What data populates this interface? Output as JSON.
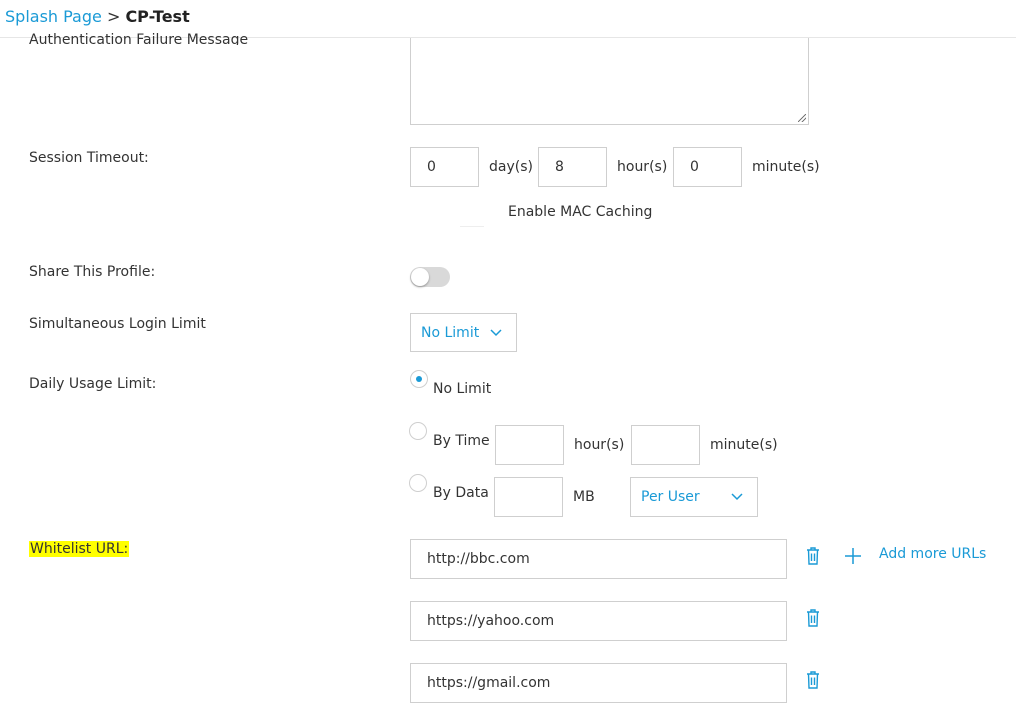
{
  "breadcrumb": {
    "parent": "Splash Page",
    "separator": " > ",
    "current": "CP-Test"
  },
  "auth_failure": {
    "label": "Authentication Failure Message",
    "value": ""
  },
  "session_timeout": {
    "label": "Session Timeout:",
    "days": "0",
    "days_unit": "day(s)",
    "hours": "8",
    "hours_unit": "hour(s)",
    "minutes": "0",
    "minutes_unit": "minute(s)",
    "mac_caching_label": "Enable MAC Caching"
  },
  "share_profile": {
    "label": "Share This Profile:",
    "enabled": false
  },
  "simultaneous_login": {
    "label": "Simultaneous Login Limit",
    "selected": "No Limit"
  },
  "daily_usage": {
    "label": "Daily Usage Limit:",
    "options": {
      "no_limit": "No Limit",
      "by_time": "By Time",
      "by_data": "By Data"
    },
    "selected": "No Limit",
    "by_time_hours_unit": "hour(s)",
    "by_time_minutes_unit": "minute(s)",
    "by_data_unit": "MB",
    "by_data_scope": "Per User"
  },
  "whitelist": {
    "label": "Whitelist URL:",
    "urls": [
      "http://bbc.com",
      "https://yahoo.com",
      "https://gmail.com"
    ],
    "add_label": "Add more URLs"
  },
  "colors": {
    "accent": "#1a9ad6",
    "highlight": "#ffff00",
    "border": "#cfcfcf"
  },
  "icons": [
    "trash-icon",
    "plus-icon",
    "chevron-down-icon",
    "resize-grip-icon"
  ]
}
